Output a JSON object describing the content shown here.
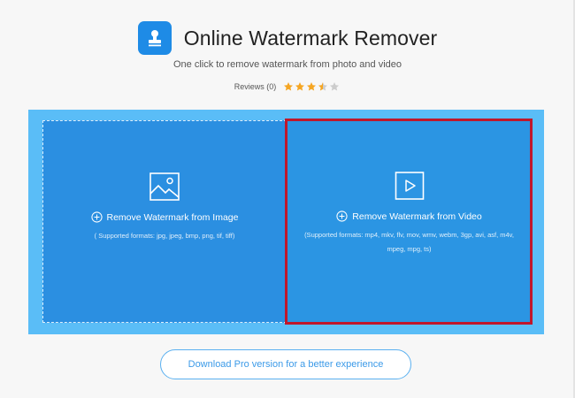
{
  "header": {
    "title": "Online Watermark Remover",
    "subtitle": "One click to remove watermark from photo and video",
    "logo_icon": "stamp-icon"
  },
  "reviews": {
    "label": "Reviews (0)",
    "rating": 3.5,
    "max_rating": 5,
    "star_color": "#f5a623",
    "empty_star_color": "#cccccc"
  },
  "panels": {
    "image": {
      "icon": "image-icon",
      "action_label": "Remove Watermark from Image",
      "formats": "( Supported formats: jpg, jpeg, bmp, png, tif, tiff)"
    },
    "video": {
      "icon": "video-play-icon",
      "action_label": "Remove Watermark from Video",
      "formats": "(Supported formats: mp4, mkv, flv, mov, wmv, webm, 3gp, avi, asf, m4v, mpeg, mpg, ts)"
    }
  },
  "download_button": {
    "label": "Download Pro version for a better experience"
  },
  "colors": {
    "accent": "#1e8be6",
    "upload_bg": "#5abdf7",
    "panel_bg": "#2b8fe1",
    "highlight": "#c0172b"
  }
}
